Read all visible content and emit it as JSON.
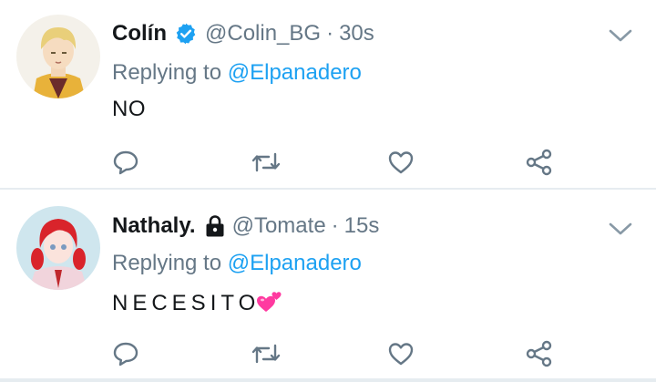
{
  "tweets": [
    {
      "display_name": "Colín",
      "handle": "@Colin_BG",
      "separator": "·",
      "time": "30s",
      "verified": true,
      "protected": false,
      "reply_prefix": "Replying to",
      "reply_to": "@Elpanadero",
      "text": "NO"
    },
    {
      "display_name": "Nathaly.",
      "handle": "@Tomate",
      "separator": "·",
      "time": "15s",
      "verified": false,
      "protected": true,
      "reply_prefix": "Replying to",
      "reply_to": "@Elpanadero",
      "text": "NECESITO"
    }
  ],
  "icons": {
    "verified": "verified-badge-icon",
    "lock": "lock-icon",
    "menu": "chevron-down-icon",
    "reply": "reply-icon",
    "retweet": "retweet-icon",
    "like": "heart-icon",
    "share": "share-icon",
    "emoji": "two-hearts-emoji-icon"
  },
  "colors": {
    "text": "#14171a",
    "secondary": "#657786",
    "link": "#1da1f2",
    "verified": "#1da1f2",
    "divider": "#e6ecf0"
  }
}
